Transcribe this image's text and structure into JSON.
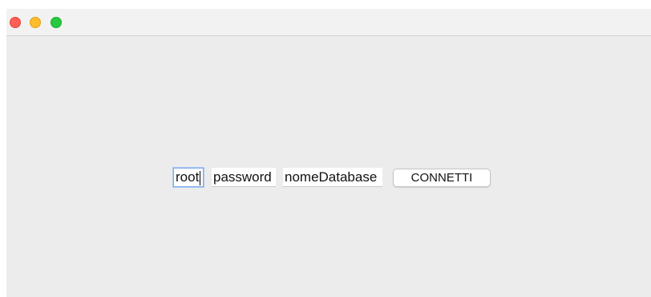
{
  "window": {
    "controls": {
      "close": "close-icon",
      "minimize": "minimize-icon",
      "maximize": "maximize-icon"
    },
    "colors": {
      "close": "#fe5f57",
      "minimize": "#febc2e",
      "maximize": "#28c840",
      "background": "#ececec"
    }
  },
  "form": {
    "user_value": "root",
    "password_value": "password",
    "database_value": "nomeDatabase",
    "connect_label": "CONNETTI"
  }
}
